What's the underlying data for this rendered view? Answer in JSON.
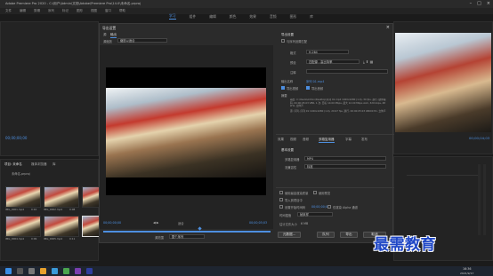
{
  "app": {
    "title": "Adobe Premiere Pro 2020 - C:\\用户\\Admin\\文档\\Adobe\\Premiere Pro\\14.0\\未命名.prproj"
  },
  "menu": [
    "文件",
    "编辑",
    "剪辑",
    "序列",
    "标记",
    "图形",
    "视图",
    "窗口",
    "帮助"
  ],
  "workspaces": [
    "学习",
    "组件",
    "编辑",
    "颜色",
    "效果",
    "音频",
    "图形",
    "库"
  ],
  "left_monitor": {
    "timecode": "00;00;00;00"
  },
  "project": {
    "tabs": [
      "项目: 未命名",
      "媒体浏览器",
      "库"
    ],
    "path": "未命名.prproj",
    "clips": [
      {
        "name": "IMG_0001.mp4",
        "dur": "0:10"
      },
      {
        "name": "IMG_0002.mp4",
        "dur": "0:08"
      },
      {
        "name": "IMG_0003.mp4",
        "dur": "0:12"
      },
      {
        "name": "IMG_0004.mp4",
        "dur": "0:09"
      },
      {
        "name": "IMG_0005.mp4",
        "dur": "0:11"
      },
      {
        "name": "IMG_0006.mp4",
        "dur": "0:07"
      }
    ]
  },
  "right_monitor": {
    "timecode": "00;00;04;03"
  },
  "dialog": {
    "title": "导出设置",
    "source_tabs": [
      "源",
      "输出"
    ],
    "source_scaling_label": "源缩放",
    "source_scaling_value": "缩放以适合",
    "timecode_left": "00;00;00;00",
    "timecode_right": "00;00;05;03",
    "fit_label": "适合",
    "source_range_label": "源范围",
    "source_range_value": "整个序列",
    "export_settings_header": "导出设置",
    "match_sequence_label": "与序列设置匹配",
    "format_label": "格式",
    "format_value": "H.264",
    "preset_label": "预设",
    "preset_value": "匹配源 - 高比特率",
    "comments_label": "注释",
    "output_name_label": "输出名称",
    "output_name_value": "序列 01.mp4",
    "export_video_label": "导出视频",
    "export_audio_label": "导出音频",
    "summary_label": "摘要",
    "summary_output": "输出: C:\\Users\\Admin\\Desktop\\序列 01.mp4 1920x1080 (1.0), 30 fps, 逐行, 硬件编码, 00:00:05:03 VBR, 1 次, 目标 10.00 Mbps, 最大 12.00 Mbps AAC, 320 kbps, 48 kHz, 立体声",
    "summary_source": "源: 序列, 序列 01 1920x1080 (1.0), 29.97 fps, 逐行, 00:00:05:03 48000 Hz, 立体声",
    "settings_tabs": [
      "效果",
      "视频",
      "音频",
      "多路复用器",
      "字幕",
      "发布"
    ],
    "settings_tabs_active": "多路复用器",
    "mux_header": "基本设置",
    "mux_label": "多路复用器",
    "mux_value": "MP4",
    "stream_label": "流兼容性",
    "stream_value": "标准",
    "use_max_render_label": "使用最高渲染质量",
    "use_previews_label": "使用预览",
    "import_project_label": "导入到项目中",
    "set_timecode_label": "设置开始时间码",
    "set_timecode_value": "00;00;00;00",
    "render_alpha_label": "仅渲染 Alpha 通道",
    "interpolation_label": "时间插值",
    "interpolation_value": "帧采样",
    "file_size_label": "估计文件大小",
    "file_size_value": "6 MB",
    "btn_metadata": "元数据...",
    "btn_queue": "队列",
    "btn_export": "导出",
    "btn_cancel": "取消"
  },
  "taskbar": {
    "time": "16:36",
    "date": "2021/9/17"
  },
  "watermark": "最需教育"
}
